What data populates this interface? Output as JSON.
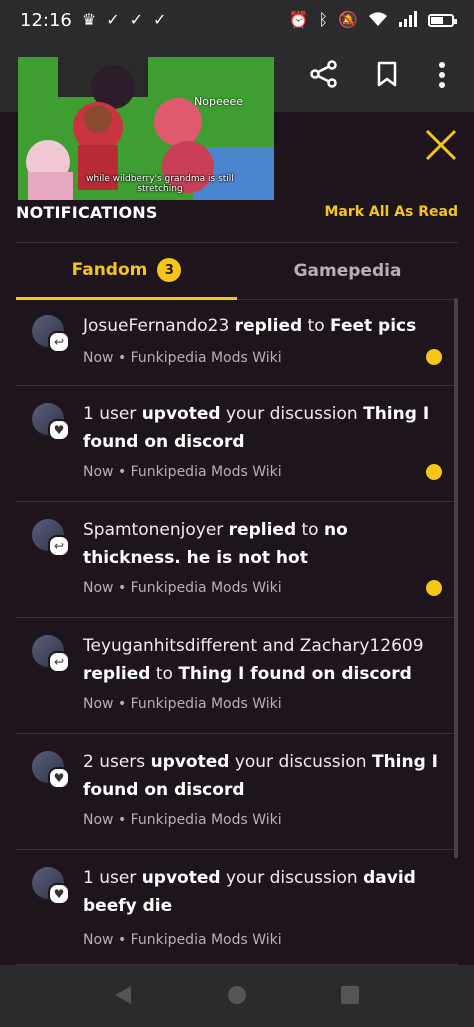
{
  "status_bar": {
    "time": "12:16",
    "left_icons": [
      "crown-icon",
      "check-icon",
      "check-icon",
      "check-icon"
    ],
    "right_icons": [
      "alarm-icon",
      "bluetooth-icon",
      "mute-bell-icon",
      "wifi-icon",
      "signal-icon",
      "battery-icon"
    ]
  },
  "top_bar": {
    "thumbnail_caption": "while wildberry's grandma is still stretching",
    "thumbnail_text": "Nopeeee",
    "buttons": [
      "share-icon",
      "bookmark-icon",
      "more-vertical-icon"
    ]
  },
  "panel": {
    "title": "NOTIFICATIONS",
    "mark_all_label": "Mark All As Read"
  },
  "tabs": [
    {
      "label": "Fandom",
      "count": "3",
      "active": true
    },
    {
      "label": "Gamepedia",
      "active": false
    }
  ],
  "notifications": [
    {
      "segments": [
        {
          "text": "JosueFernando23 ",
          "bold": false
        },
        {
          "text": "replied",
          "bold": true
        },
        {
          "text": " to ",
          "bold": false
        },
        {
          "text": "Feet pics",
          "bold": true
        }
      ],
      "meta": "Now • Funkipedia Mods Wiki",
      "unread": true,
      "kind": "reply"
    },
    {
      "segments": [
        {
          "text": "1 user ",
          "bold": false
        },
        {
          "text": "upvoted",
          "bold": true
        },
        {
          "text": " your discussion ",
          "bold": false
        },
        {
          "text": "Thing I found on discord",
          "bold": true
        }
      ],
      "meta": "Now • Funkipedia Mods Wiki",
      "unread": true,
      "kind": "upvote"
    },
    {
      "segments": [
        {
          "text": "Spamtonenjoyer ",
          "bold": false
        },
        {
          "text": "replied",
          "bold": true
        },
        {
          "text": " to ",
          "bold": false
        },
        {
          "text": "no thickness. he is not hot",
          "bold": true
        }
      ],
      "meta": "Now • Funkipedia Mods Wiki",
      "unread": true,
      "kind": "reply"
    },
    {
      "segments": [
        {
          "text": "Teyuganhitsdifferent and Zachary12609 ",
          "bold": false
        },
        {
          "text": "replied",
          "bold": true
        },
        {
          "text": " to ",
          "bold": false
        },
        {
          "text": "Thing I found on discord",
          "bold": true
        }
      ],
      "meta": "Now • Funkipedia Mods Wiki",
      "unread": false,
      "kind": "reply"
    },
    {
      "segments": [
        {
          "text": "2 users ",
          "bold": false
        },
        {
          "text": "upvoted",
          "bold": true
        },
        {
          "text": " your discussion ",
          "bold": false
        },
        {
          "text": "Thing I found on discord",
          "bold": true
        }
      ],
      "meta": "Now • Funkipedia Mods Wiki",
      "unread": false,
      "kind": "upvote"
    },
    {
      "segments": [
        {
          "text": "1 user ",
          "bold": false
        },
        {
          "text": "upvoted",
          "bold": true
        },
        {
          "text": " your discussion ",
          "bold": false
        },
        {
          "text": "david beefy die",
          "bold": true
        }
      ],
      "meta": "Now • Funkipedia Mods Wiki",
      "unread": false,
      "kind": "upvote"
    }
  ],
  "colors": {
    "accent": "#f5c518",
    "background": "#1e141c",
    "bar": "#2b2b2d"
  }
}
